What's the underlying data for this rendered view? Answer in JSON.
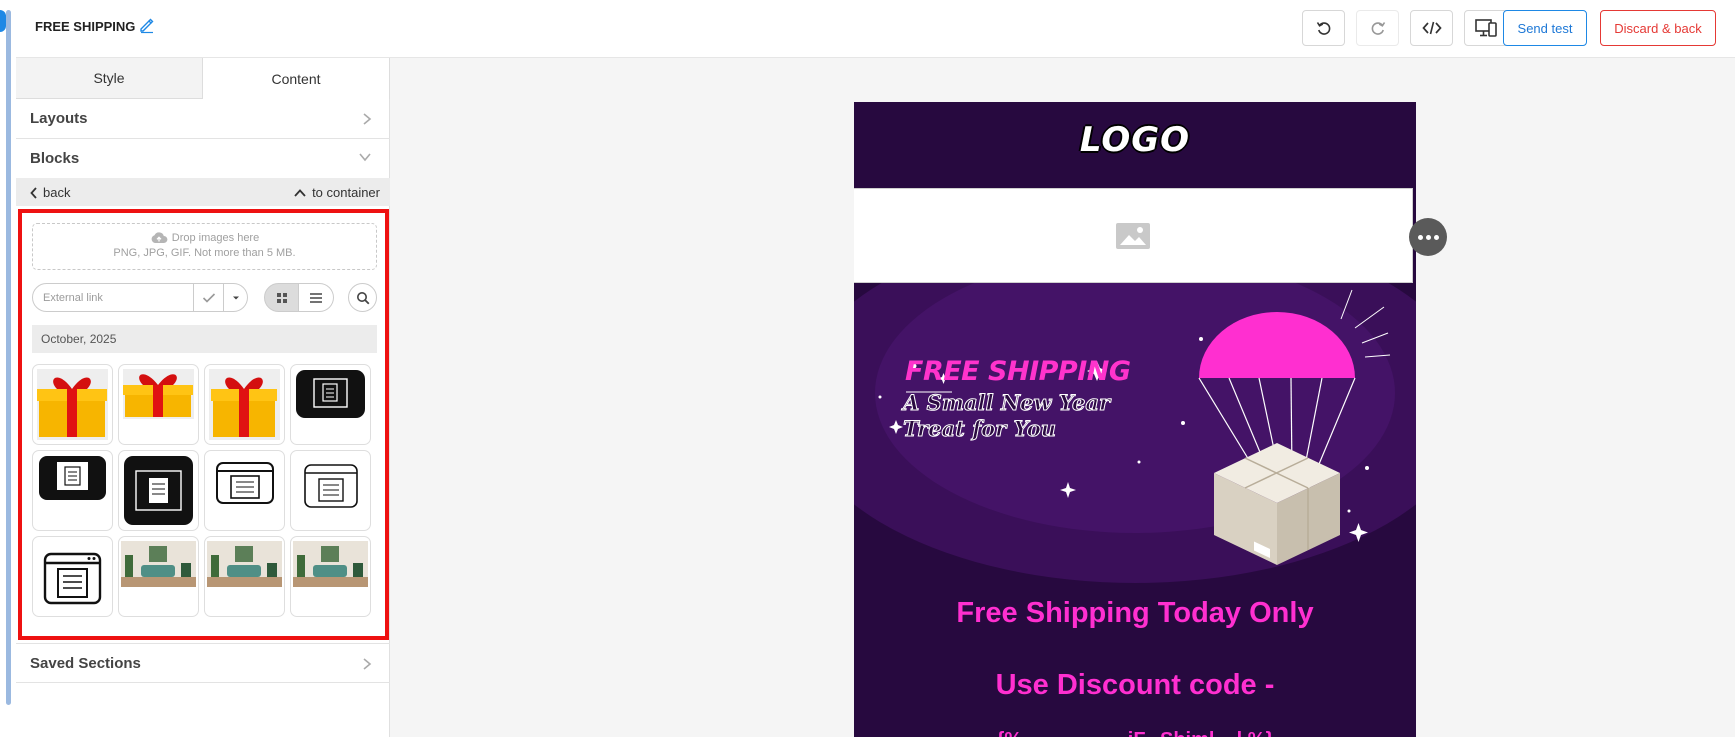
{
  "header": {
    "title": "FREE SHIPPING",
    "send_test_label": "Send test",
    "discard_label": "Discard & back"
  },
  "sidebar": {
    "tabs": [
      {
        "label": "Style",
        "active": false
      },
      {
        "label": "Content",
        "active": true
      }
    ],
    "layouts_label": "Layouts",
    "blocks_label": "Blocks",
    "back_label": "back",
    "to_container_label": "to container",
    "dropzone": {
      "title": "Drop images here",
      "hint": "PNG, JPG, GIF. Not more than 5 MB."
    },
    "external_link_placeholder": "External link",
    "month_label": "October, 2025",
    "saved_sections_label": "Saved Sections"
  },
  "email": {
    "logo_text": "LOGO",
    "hero_title": "FREE SHIPPING",
    "hero_sub_line1": "A Small New Year",
    "hero_sub_line2": "Treat for You",
    "headline1": "Free Shipping Today Only",
    "headline2": "Use Discount code -",
    "trailing_text": "{%.................. iF...Shiml.. .l %}"
  },
  "colors": {
    "accent": "#1e88e5",
    "danger": "#e53935",
    "highlight_border": "#ee1111",
    "email_bg": "#27093f",
    "email_pink": "#ff2fd0"
  }
}
